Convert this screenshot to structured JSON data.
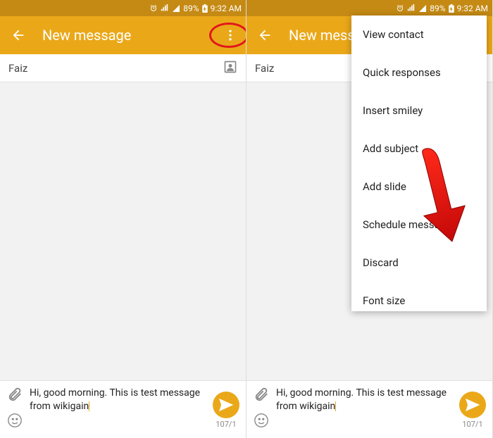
{
  "statusbar": {
    "battery": "89%",
    "time": "9:32 AM"
  },
  "appbar": {
    "title": "New message",
    "title_truncated": "New messa"
  },
  "recipient": {
    "name": "Faiz"
  },
  "composer": {
    "text": "Hi, good morning. This is test message from wikigain",
    "counter": "107/1"
  },
  "menu": {
    "items": [
      "View contact",
      "Quick responses",
      "Insert smiley",
      "Add subject",
      "Add slide",
      "Schedule message",
      "Discard",
      "Font size"
    ]
  }
}
